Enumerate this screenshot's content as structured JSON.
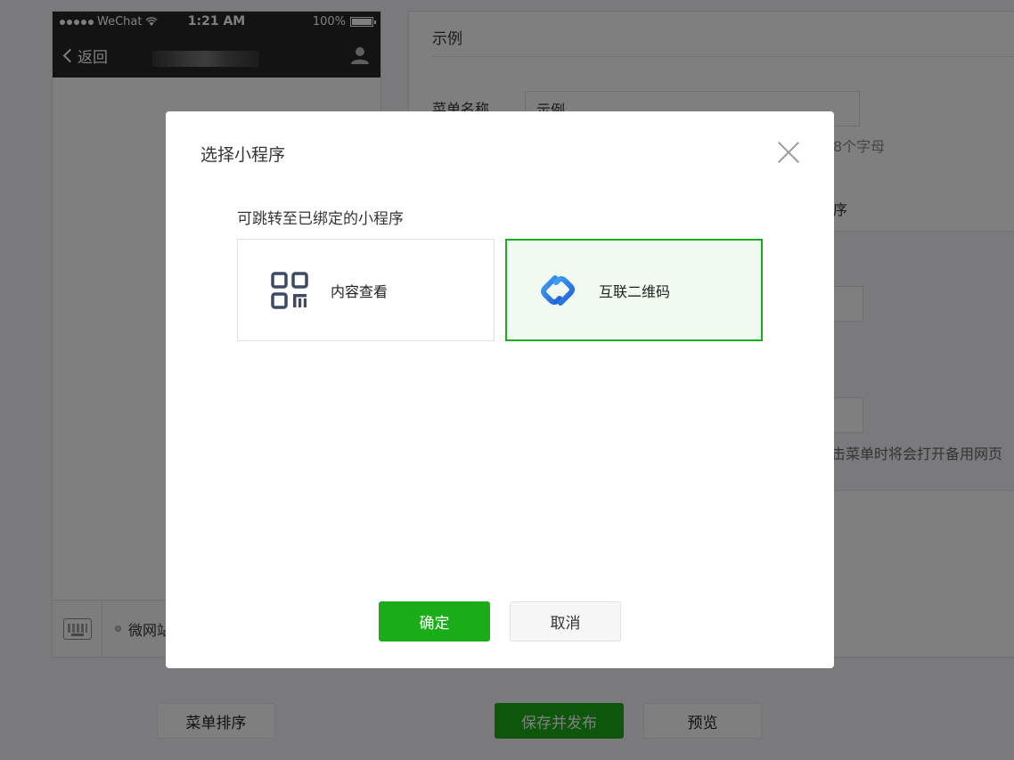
{
  "phone": {
    "carrier": "WeChat",
    "time": "1:21 AM",
    "battery": "100%",
    "back_label": "返回",
    "menu_item": "微网站"
  },
  "editor": {
    "title": "示例",
    "name_label": "菜单名称",
    "name_value": "示例",
    "name_tip": "8个字母",
    "tab_text": "序",
    "backup_tip": "击菜单时将会打开备用网页"
  },
  "bottom": {
    "sort_label": "菜单排序",
    "save_label": "保存并发布",
    "preview_label": "预览"
  },
  "dialog": {
    "title": "选择小程序",
    "subtitle": "可跳转至已绑定的小程序",
    "cards": [
      {
        "label": "内容查看",
        "icon": "qr-grid-icon",
        "selected": false
      },
      {
        "label": "互联二维码",
        "icon": "chain-link-icon",
        "selected": true
      }
    ],
    "confirm_label": "确定",
    "cancel_label": "取消"
  },
  "colors": {
    "accent": "#1aad19",
    "selected_bg": "#f0faf0",
    "icon_dark": "#3d4a63",
    "icon_blue": "#2b7fe0"
  }
}
